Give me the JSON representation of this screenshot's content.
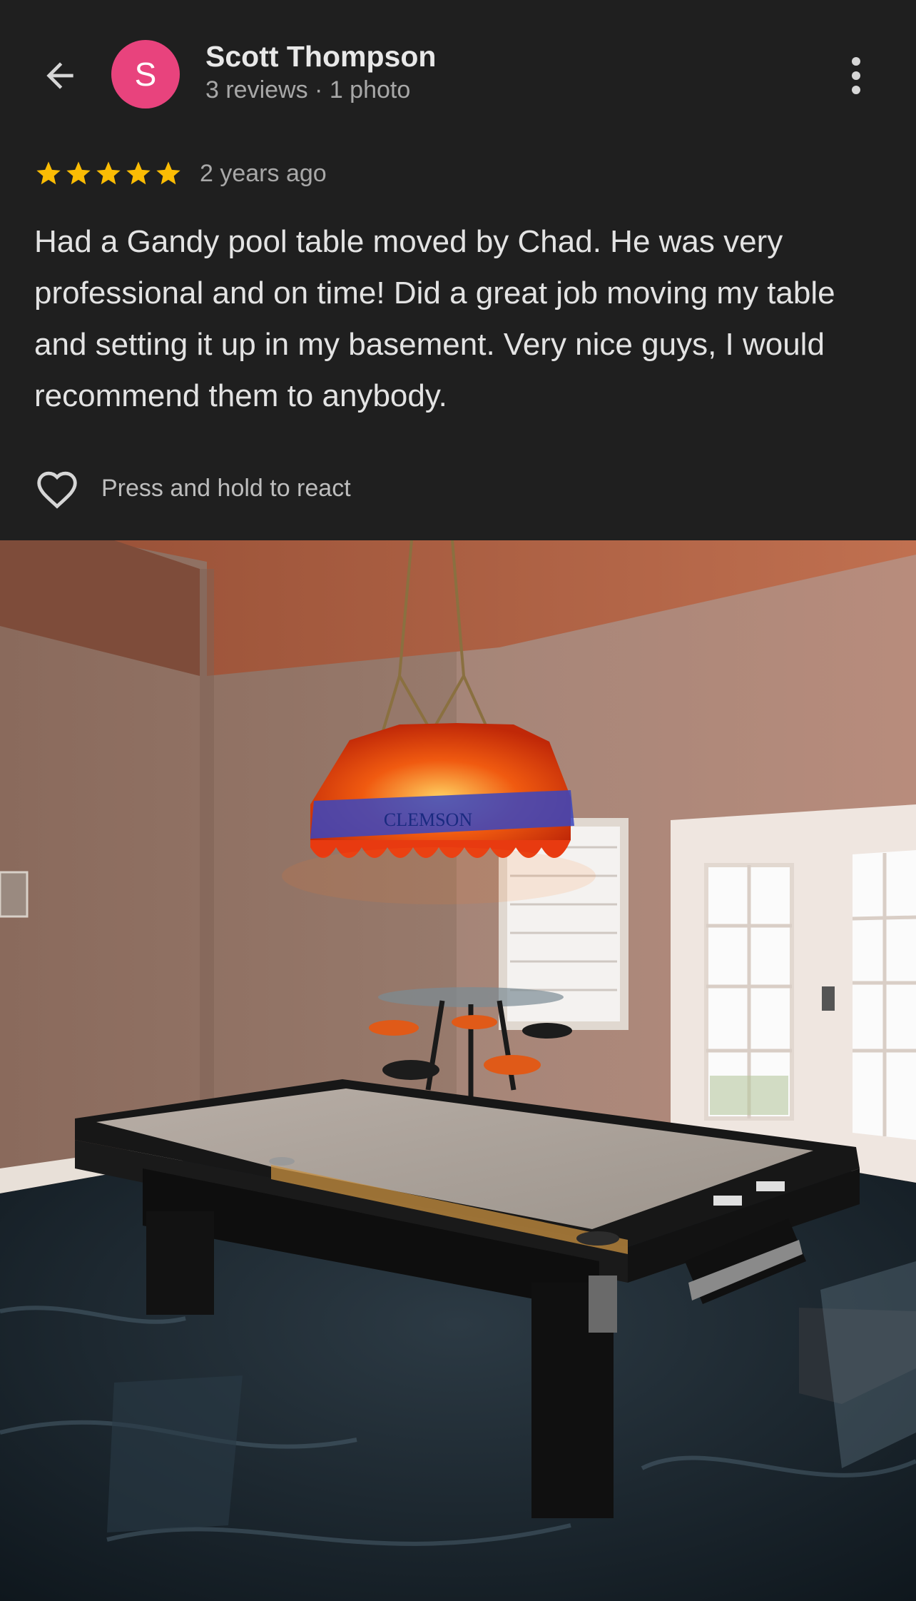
{
  "header": {
    "back_icon": "arrow-left-icon",
    "avatar_letter": "S",
    "avatar_color": "#e8437d",
    "user_name": "Scott Thompson",
    "user_meta": "3 reviews · 1 photo",
    "more_icon": "more-vertical-icon"
  },
  "review": {
    "rating": 5,
    "star_color": "#fbbc04",
    "time": "2 years ago",
    "text": "Had a Gandy pool table moved by Chad. He was very professional and on time! Did a great job moving my table and setting it up in my basement. Very nice guys, I would recommend them to anybody."
  },
  "react": {
    "icon": "heart-outline-icon",
    "label": "Press and hold to react"
  },
  "photo": {
    "description_icon": "review-photo",
    "lamp_text": "CLEMSON"
  }
}
